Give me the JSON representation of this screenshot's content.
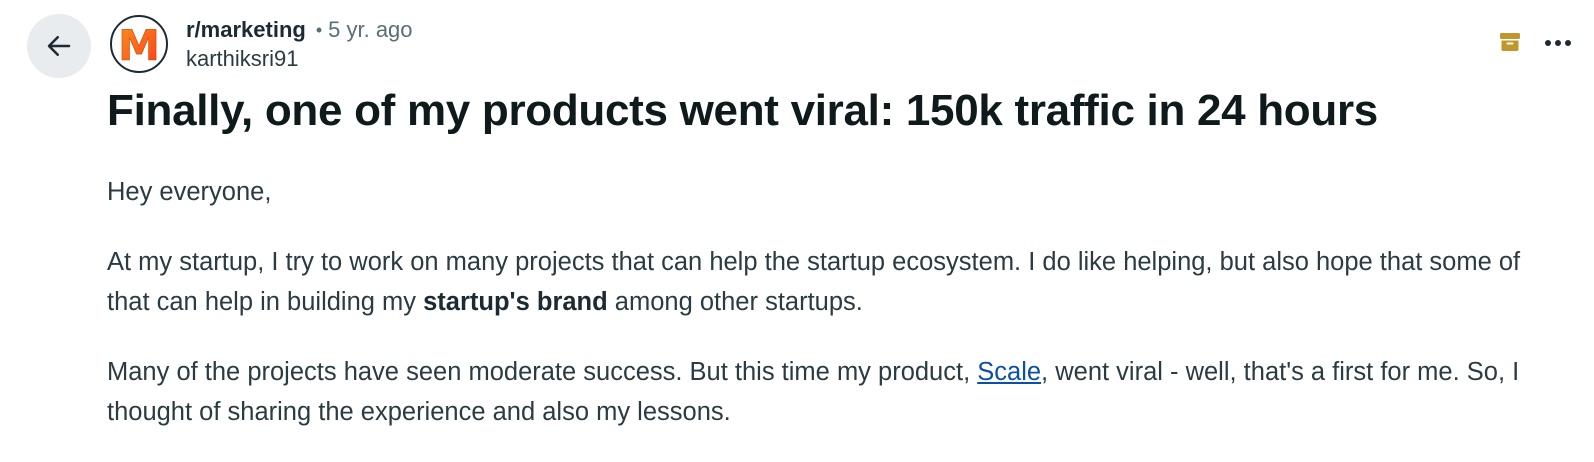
{
  "header": {
    "subreddit": "r/marketing",
    "separator": "•",
    "age": "5 yr. ago",
    "author": "karthiksri91",
    "avatar_letter": "M"
  },
  "icons": {
    "back": "arrow-left-icon",
    "archived": "archive-box-icon",
    "more": "more-options-icon"
  },
  "colors": {
    "archive_icon": "#c1962b",
    "link": "#0b4fa8",
    "avatar_gradient": [
      "#f7931e",
      "#ff3c1a"
    ]
  },
  "post": {
    "title": "Finally, one of my products went viral: 150k traffic in 24 hours",
    "p1": "Hey everyone,",
    "p2_before": "At my startup, I try to work on many projects that can help the startup ecosystem. I do like helping, but also hope that some of that can help in building my ",
    "p2_bold": "startup's brand",
    "p2_after": " among other startups.",
    "p3_before": "Many of the projects have seen moderate success. But this time my product, ",
    "p3_link": "Scale",
    "p3_after": ", went viral - well, that's a first for me. So, I thought of sharing the experience and also my lessons."
  }
}
